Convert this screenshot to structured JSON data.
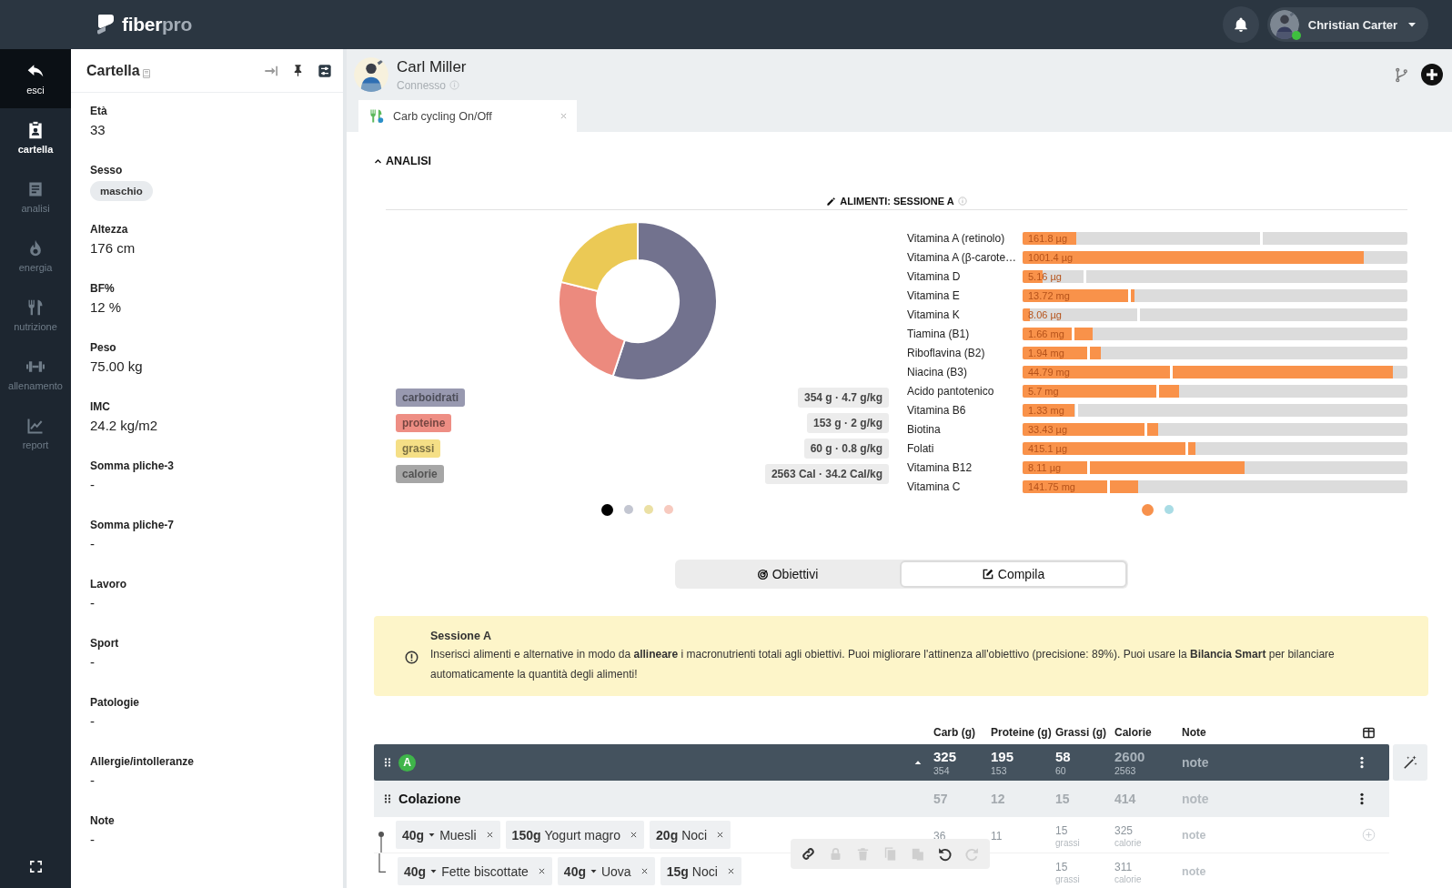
{
  "topbar": {
    "brand": [
      {
        "text": "fiber",
        "muted": false
      },
      {
        "text": "pro",
        "muted": true
      }
    ],
    "user": {
      "name": "Christian Carter",
      "online": true
    }
  },
  "rail": {
    "items": [
      {
        "label": "esci",
        "kind": "exit",
        "selected": false
      },
      {
        "label": "cartella",
        "kind": "record",
        "selected": true
      },
      {
        "label": "analisi",
        "kind": "analysis",
        "selected": false
      },
      {
        "label": "energia",
        "kind": "energy",
        "selected": false
      },
      {
        "label": "nutrizione",
        "kind": "nutrition",
        "selected": false
      },
      {
        "label": "allenamento",
        "kind": "training",
        "selected": false
      },
      {
        "label": "report",
        "kind": "report",
        "selected": false
      }
    ]
  },
  "panel": {
    "title": "Cartella",
    "fields": [
      {
        "label": "Età",
        "value": "33",
        "kind": "text"
      },
      {
        "label": "Sesso",
        "value": "maschio",
        "kind": "chip"
      },
      {
        "label": "Altezza",
        "value": "176 cm",
        "kind": "text"
      },
      {
        "label": "BF%",
        "value": "12 %",
        "kind": "text"
      },
      {
        "label": "Peso",
        "value": "75.00 kg",
        "kind": "text"
      },
      {
        "label": "IMC",
        "value": "24.2 kg/m2",
        "kind": "text"
      },
      {
        "label": "Somma pliche-3",
        "value": "-",
        "kind": "text"
      },
      {
        "label": "Somma pliche-7",
        "value": "-",
        "kind": "text"
      },
      {
        "label": "Lavoro",
        "value": "-",
        "kind": "text"
      },
      {
        "label": "Sport",
        "value": "-",
        "kind": "text"
      },
      {
        "label": "Patologie",
        "value": "-",
        "kind": "text"
      },
      {
        "label": "Allergie/intolleranze",
        "value": "-",
        "kind": "text"
      },
      {
        "label": "Note",
        "value": "-",
        "kind": "text"
      }
    ]
  },
  "patient": {
    "name": "Carl Miller",
    "status": "Connesso"
  },
  "tabs": [
    {
      "label": "Carb cycling On/Off",
      "selected": true
    }
  ],
  "analysis": {
    "title": "ANALISI",
    "expanded": true,
    "section_title": "ALIMENTI: SESSIONE A",
    "macros": {
      "chart_data": {
        "type": "donut",
        "values": [
          55.1,
          23.8,
          21.1
        ],
        "colors": [
          "#72728e",
          "#ec8a7e",
          "#ebc955"
        ]
      },
      "legend": [
        {
          "label": "carboidrati",
          "value": "354 g · 4.7 g/kg",
          "color": "#9899b0"
        },
        {
          "label": "proteine",
          "value": "153 g · 2 g/kg",
          "color": "#ee8e84"
        },
        {
          "label": "grassi",
          "value": "60 g · 0.8 g/kg",
          "color": "#f5df86"
        },
        {
          "label": "calorie",
          "value": "2563 Cal · 34.2 Cal/kg",
          "color": "#a6a6a6"
        }
      ],
      "pager": [
        {
          "selected": true,
          "color": "#000000"
        },
        {
          "selected": false,
          "color": "#c3c6d1"
        },
        {
          "selected": false,
          "color": "#ebe0a4"
        },
        {
          "selected": false,
          "color": "#f7cabf"
        }
      ]
    },
    "vitamins": {
      "nutrients": [
        {
          "name": "Vitamina A (retinolo)",
          "reading": "161.8 µg",
          "level": 0.14,
          "target": {
            "level": 0.62
          }
        },
        {
          "name": "Vitamina A (β-carote…",
          "reading": "1001.4 µg",
          "level": 0.886
        },
        {
          "name": "Vitamina D",
          "reading": "5.16 µg",
          "level": 0.053,
          "target": {
            "level": 0.16
          }
        },
        {
          "name": "Vitamina E",
          "reading": "13.72 mg",
          "level": 0.29,
          "target": {
            "level": 0.276
          }
        },
        {
          "name": "Vitamina K",
          "reading": "8.06 µg",
          "level": 0.02,
          "target": {
            "level": 0.3
          }
        },
        {
          "name": "Tiamina (B1)",
          "reading": "1.66 mg",
          "level": 0.183,
          "target": {
            "level": 0.129
          }
        },
        {
          "name": "Riboflavina (B2)",
          "reading": "1.94 mg",
          "level": 0.204,
          "target": {
            "level": 0.17
          }
        },
        {
          "name": "Niacina (B3)",
          "reading": "44.79 mg",
          "level": 0.962,
          "target": {
            "level": 0.385
          }
        },
        {
          "name": "Acido pantotenico",
          "reading": "5.7 mg",
          "level": 0.407,
          "target": {
            "level": 0.351
          }
        },
        {
          "name": "Vitamina B6",
          "reading": "1.33 mg",
          "level": 0.134,
          "target": {
            "level": 0.139
          }
        },
        {
          "name": "Biotina",
          "reading": "33.43 µg",
          "level": 0.353,
          "target": {
            "level": 0.319
          }
        },
        {
          "name": "Folati",
          "reading": "415.1 µg",
          "level": 0.449,
          "target": {
            "level": 0.426
          }
        },
        {
          "name": "Vitamina B12",
          "reading": "8.11 µg",
          "level": 0.576,
          "target": {
            "level": 0.17
          }
        },
        {
          "name": "Vitamina C",
          "reading": "141.75 mg",
          "level": 0.3,
          "target": {
            "level": 0.223
          }
        }
      ],
      "pager": [
        {
          "selected": true,
          "color": "#f7914c"
        },
        {
          "selected": false,
          "color": "#a9dce5"
        }
      ]
    }
  },
  "view_toggle": [
    {
      "label": "Obiettivi",
      "kind": "target",
      "selected": false
    },
    {
      "label": "Compila",
      "kind": "edit",
      "selected": true
    }
  ],
  "notice": {
    "title": "Sessione A",
    "text": "Inserisci alimenti e alternative in modo da **allineare** i macronutrienti totali agli obiettivi. Puoi migliorare l'attinenza all'obiettivo (precisione: 89%). Puoi usare la **Bilancia Smart** per bilanciare automaticamente la quantità degli alimenti!"
  },
  "table": {
    "columns": [
      "Carb (g)",
      "Proteine (g)",
      "Grassi (g)",
      "Calorie",
      "Note"
    ],
    "group": {
      "badge": "A",
      "expanded": true,
      "cells": [
        {
          "value": "325",
          "target": "354",
          "muted": false
        },
        {
          "value": "195",
          "target": "153",
          "muted": false
        },
        {
          "value": "58",
          "target": "60",
          "muted": false
        },
        {
          "value": "2600",
          "target": "2563",
          "muted": true
        }
      ],
      "note": "note"
    },
    "meals": [
      {
        "name": "Colazione",
        "cells": [
          "57",
          "12",
          "15",
          "414"
        ],
        "note": "note",
        "foods": [
          {
            "items": [
              {
                "qty": "40g",
                "dropdown": true,
                "name": "Muesli"
              },
              {
                "qty": "150g",
                "dropdown": false,
                "name": "Yogurt magro"
              },
              {
                "qty": "20g",
                "dropdown": false,
                "name": "Noci"
              }
            ],
            "cells": [
              {
                "value": "36"
              },
              {
                "value": "11"
              },
              {
                "value": "15",
                "sub": "grassi"
              },
              {
                "value": "325",
                "sub": "calorie"
              }
            ],
            "note": "note",
            "addable": true
          },
          {
            "items": [
              {
                "qty": "40g",
                "dropdown": true,
                "name": "Fette biscottate"
              },
              {
                "qty": "40g",
                "dropdown": true,
                "name": "Uova"
              },
              {
                "qty": "15g",
                "dropdown": false,
                "name": "Noci"
              }
            ],
            "cells": [
              null,
              null,
              {
                "value": "15",
                "sub": "grassi"
              },
              {
                "value": "311",
                "sub": "calorie"
              }
            ],
            "note": "note",
            "addable": false
          }
        ]
      }
    ],
    "toolbar": [
      {
        "kind": "link",
        "disabled": false
      },
      {
        "kind": "lock",
        "disabled": true
      },
      {
        "kind": "trash",
        "disabled": true
      },
      {
        "kind": "copy",
        "disabled": true
      },
      {
        "kind": "paste",
        "disabled": true
      },
      {
        "kind": "undo",
        "disabled": false
      },
      {
        "kind": "redo",
        "disabled": true
      }
    ]
  }
}
